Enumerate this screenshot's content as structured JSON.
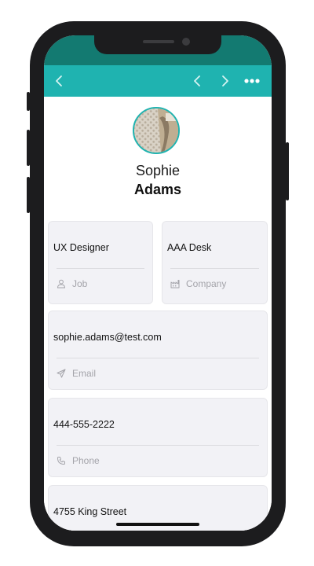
{
  "colors": {
    "status_bar": "#137a71",
    "nav_bar": "#1fb3b0",
    "card_bg": "#f2f2f6",
    "label": "#a4a4aa"
  },
  "nav": {
    "back_icon": "chevron-left-icon",
    "prev_icon": "chevron-left-icon",
    "next_icon": "chevron-right-icon",
    "more_icon": "ellipsis-icon"
  },
  "profile": {
    "first_name": "Sophie",
    "last_name": "Adams"
  },
  "fields": {
    "job": {
      "value": "UX Designer",
      "label": "Job",
      "icon": "person-icon"
    },
    "company": {
      "value": "AAA Desk",
      "label": "Company",
      "icon": "factory-icon"
    },
    "email": {
      "value": "sophie.adams@test.com",
      "label": "Email",
      "icon": "paper-plane-icon"
    },
    "phone": {
      "value": "444-555-2222",
      "label": "Phone",
      "icon": "phone-icon"
    },
    "address": {
      "value": "4755 King Street"
    }
  }
}
